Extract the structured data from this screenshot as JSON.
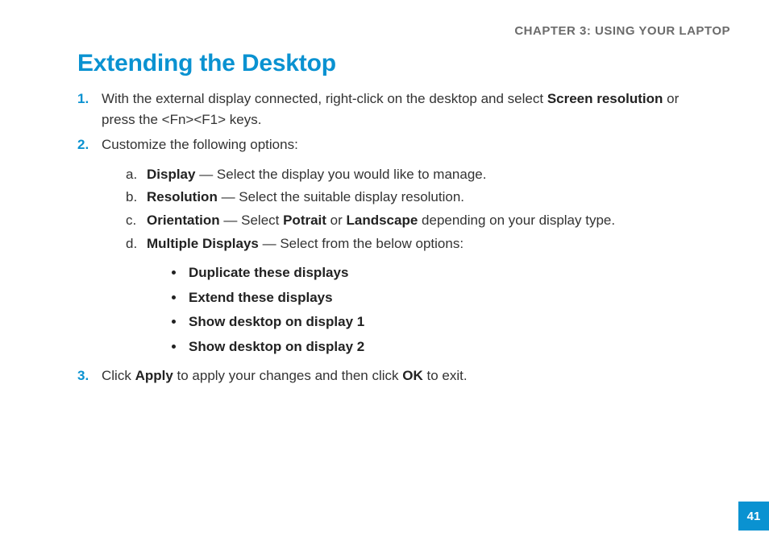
{
  "chapter_header": "CHAPTER 3: USING YOUR LAPTOP",
  "title": "Extending the Desktop",
  "steps": {
    "s1": {
      "pre": "With the external display connected, right-click on the desktop and select ",
      "bold1": "Screen resolution",
      "mid": " or press the <Fn><F1> keys."
    },
    "s2": {
      "text": "Customize the following options:",
      "sub": {
        "a": {
          "bold": "Display",
          "rest": " — Select the display you would like to manage."
        },
        "b": {
          "bold": "Resolution",
          "rest": " — Select the suitable display resolution."
        },
        "c": {
          "bold": "Orientation",
          "rest_pre": " — Select ",
          "opt1": "Potrait",
          "rest_mid": " or ",
          "opt2": "Landscape",
          "rest_post": " depending on your display type."
        },
        "d": {
          "bold": "Multiple Displays",
          "rest": " — Select from the below options:"
        }
      },
      "bullets": {
        "b1": "Duplicate these displays",
        "b2": "Extend these displays",
        "b3": "Show desktop on display 1",
        "b4": "Show desktop on display 2"
      }
    },
    "s3": {
      "pre": "Click ",
      "bold1": "Apply",
      "mid": " to apply your changes and then click ",
      "bold2": "OK",
      "post": " to exit."
    }
  },
  "page_number": "41",
  "colors": {
    "accent": "#0a92d1",
    "header_gray": "#6b6b6b"
  }
}
